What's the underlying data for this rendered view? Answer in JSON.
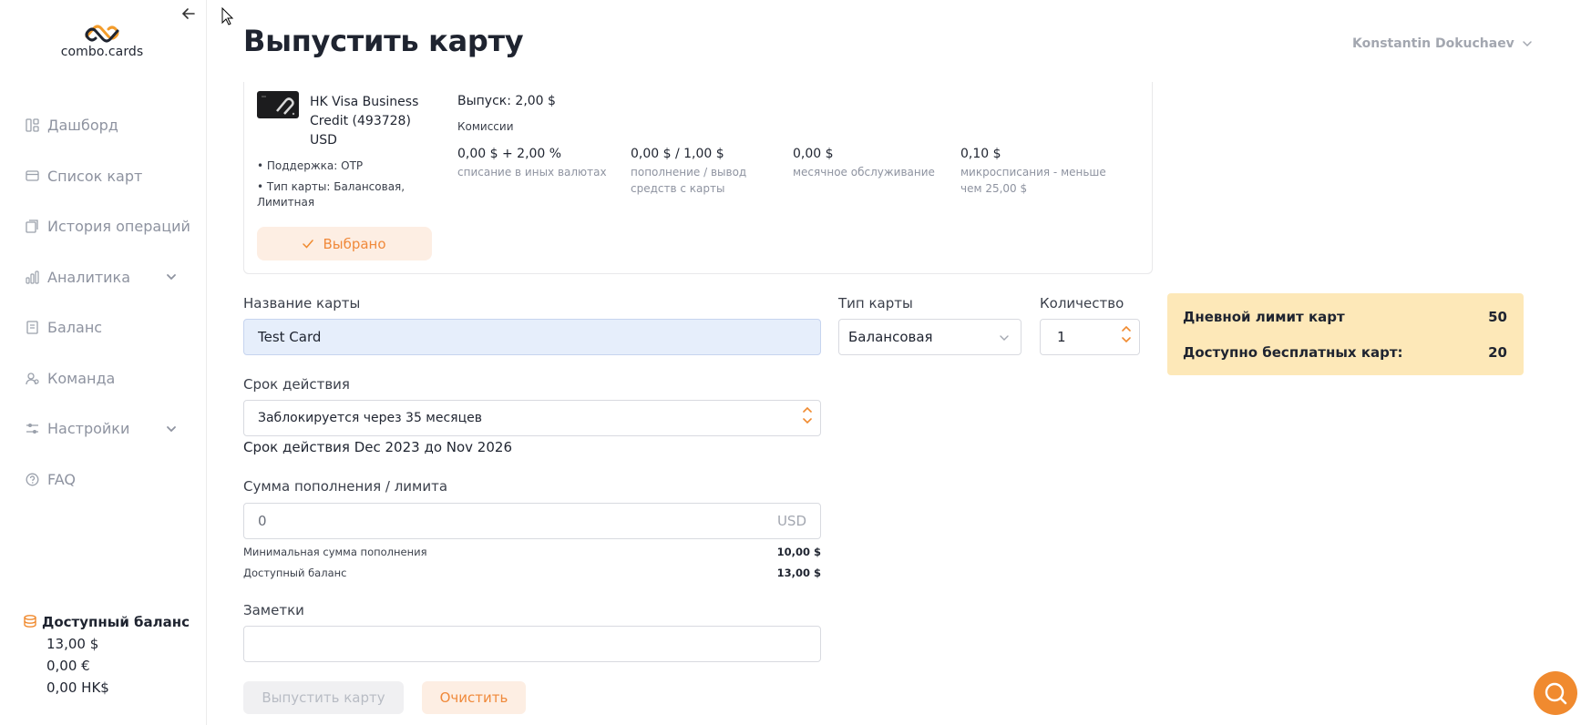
{
  "app": {
    "logo_text": "combo.cards"
  },
  "header": {
    "title": "Выпустить карту",
    "user_name": "Konstantin Dokuchaev"
  },
  "sidebar": {
    "items": [
      {
        "label": "Дашборд",
        "icon": "dashboard-icon"
      },
      {
        "label": "Список карт",
        "icon": "card-icon"
      },
      {
        "label": "История операций",
        "icon": "history-icon"
      },
      {
        "label": "Аналитика",
        "icon": "chart-icon",
        "expandable": true
      },
      {
        "label": "Баланс",
        "icon": "balance-icon"
      },
      {
        "label": "Команда",
        "icon": "team-icon"
      },
      {
        "label": "Настройки",
        "icon": "settings-icon",
        "expandable": true
      },
      {
        "label": "FAQ",
        "icon": "help-icon"
      }
    ],
    "balance": {
      "title": "Доступный баланс",
      "values": [
        "13,00 $",
        "0,00 €",
        "0,00 HK$"
      ]
    }
  },
  "card": {
    "name": "HK Visa Business Credit (493728) USD",
    "bullets": [
      "• Поддержка: OTP",
      "• Тип карты: Балансовая, Лимитная"
    ],
    "selected_label": "Выбрано",
    "issue_price": "Выпуск: 2,00 $",
    "commission_title": "Комиссии",
    "fees": [
      {
        "value": "0,00 $ + 2,00 %",
        "desc": "списание в иных валютах"
      },
      {
        "value": "0,00 $ / 1,00 $",
        "desc": "пополнение / вывод средств с карты"
      },
      {
        "value": "0,00 $",
        "desc": "месячное обслуживание"
      },
      {
        "value": "0,10 $",
        "desc": "микросписания - меньше чем 25,00 $"
      }
    ]
  },
  "form": {
    "card_name_label": "Название карты",
    "card_name_value": "Test Card",
    "card_type_label": "Тип карты",
    "card_type_value": "Балансовая",
    "quantity_label": "Количество",
    "quantity_value": "1",
    "validity_label": "Срок действия",
    "validity_value": "Заблокируется через 35 месяцев",
    "validity_range": "Срок действия  Dec 2023 до Nov 2026",
    "amount_label": "Сумма пополнения / лимита",
    "amount_value": "0",
    "amount_currency": "USD",
    "min_topup_label": "Минимальная сумма  пополнения",
    "min_topup_value": "10,00 $",
    "available_label": "Доступный баланс",
    "available_value": "13,00 $",
    "notes_label": "Заметки",
    "notes_value": ""
  },
  "limits": {
    "daily_label": "Дневной лимит карт",
    "daily_value": "50",
    "free_label": "Доступно бесплатных карт:",
    "free_value": "20"
  },
  "actions": {
    "issue_label": "Выпустить карту",
    "clear_label": "Очистить"
  },
  "colors": {
    "accent": "#f08a2f",
    "accent_light": "#fdeee3",
    "limits_bg": "#fde8b8",
    "filled_input": "#e6eefb"
  }
}
